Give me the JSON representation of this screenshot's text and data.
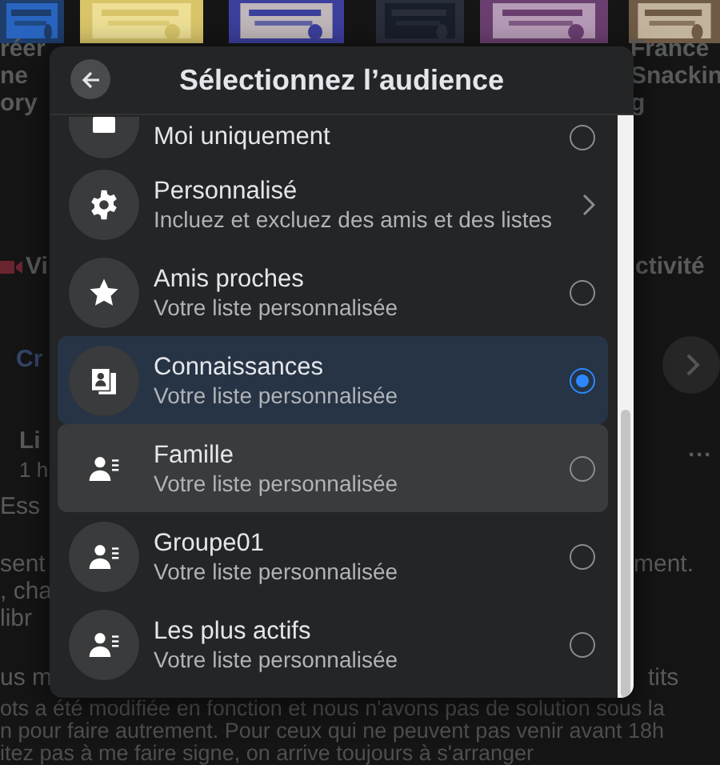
{
  "background": {
    "story_labels_left": [
      "réer",
      "ne",
      "ory"
    ],
    "story_labels_right": [
      "France",
      "Snackin",
      "g"
    ],
    "action_left": "Vi",
    "action_right": "ctivité",
    "create": "Cr",
    "post": {
      "author": "Li",
      "time": "1 h",
      "more": "···",
      "lines_left": [
        "Ess",
        "sent",
        ", cha",
        "libr",
        "us m"
      ],
      "lines_right": [
        "ment.",
        "tits"
      ],
      "bottom_lines": [
        "ots a été modifiée en fonction et nous n'avons pas de solution sous la",
        "n pour faire autrement. Pour ceux qui ne peuvent pas venir avant 18h",
        "itez pas à me faire signe, on arrive toujours à s'arranger"
      ]
    }
  },
  "dialog": {
    "title": "Sélectionnez l’audience",
    "options": [
      {
        "kind": "radio",
        "label": "Moi uniquement",
        "selected": false,
        "highlighted": false
      },
      {
        "kind": "submenu",
        "label": "Personnalisé",
        "description": "Incluez et excluez des amis et des listes",
        "highlighted": false
      },
      {
        "kind": "radio",
        "label": "Amis proches",
        "description": "Votre liste personnalisée",
        "selected": false,
        "highlighted": false
      },
      {
        "kind": "radio",
        "label": "Connaissances",
        "description": "Votre liste personnalisée",
        "selected": true,
        "highlighted": false
      },
      {
        "kind": "radio",
        "label": "Famille",
        "description": "Votre liste personnalisée",
        "selected": false,
        "highlighted": true
      },
      {
        "kind": "radio",
        "label": "Groupe01",
        "description": "Votre liste personnalisée",
        "selected": false,
        "highlighted": false
      },
      {
        "kind": "radio",
        "label": "Les plus actifs",
        "description": "Votre liste personnalisée",
        "selected": false,
        "highlighted": false
      }
    ]
  }
}
